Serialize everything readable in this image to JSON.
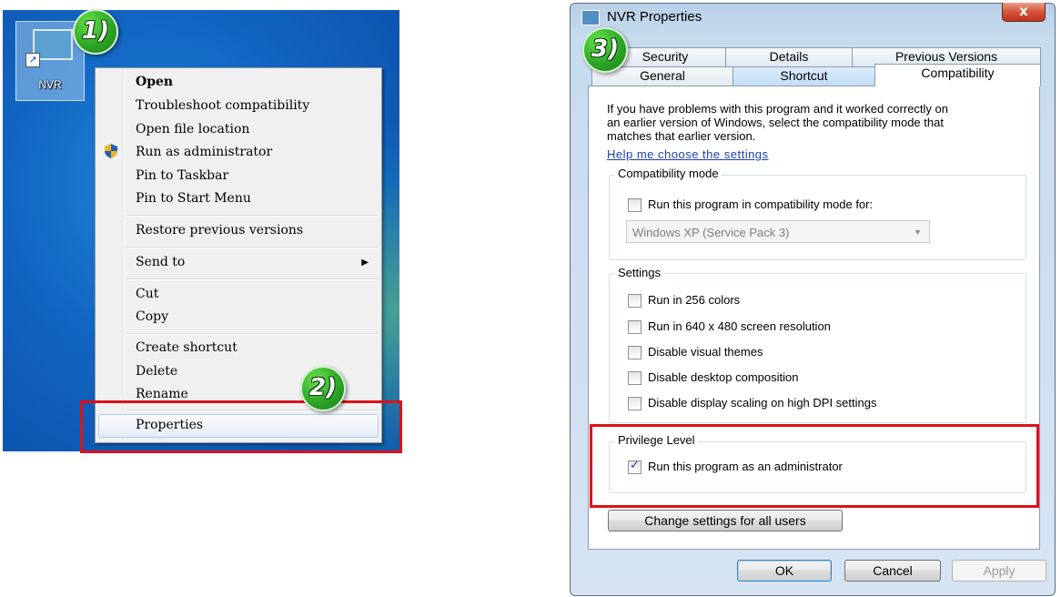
{
  "desktop": {
    "icon_label": "NVR"
  },
  "badges": {
    "step1": "1)",
    "step2": "2)",
    "step3": "3)"
  },
  "context_menu": {
    "items": [
      {
        "label": "Open",
        "bold": true
      },
      {
        "label": "Troubleshoot compatibility"
      },
      {
        "label": "Open file location"
      },
      {
        "label": "Run as administrator",
        "icon": "shield-icon"
      },
      {
        "label": "Pin to Taskbar"
      },
      {
        "label": "Pin to Start Menu"
      },
      {
        "label": "Restore previous versions"
      },
      {
        "label": "Send to",
        "submenu": true
      },
      {
        "label": "Cut"
      },
      {
        "label": "Copy"
      },
      {
        "label": "Create shortcut"
      },
      {
        "label": "Delete"
      },
      {
        "label": "Rename"
      },
      {
        "label": "Properties",
        "highlighted": true
      }
    ]
  },
  "dialog": {
    "title": "NVR Properties",
    "close_label": "x",
    "tabs_row1": [
      "Security",
      "Details",
      "Previous Versions"
    ],
    "tabs_row2": [
      "General",
      "Shortcut",
      "Compatibility"
    ],
    "active_tab": "Compatibility",
    "intro_lines": [
      "If you have problems with this program and it worked correctly on",
      "an earlier version of Windows, select the compatibility mode that",
      "matches that earlier version."
    ],
    "help_link": "Help me choose the settings",
    "compat_mode": {
      "legend": "Compatibility mode",
      "checkbox_label": "Run this program in compatibility mode for:",
      "checked": false,
      "select_value": "Windows XP (Service Pack 3)"
    },
    "settings": {
      "legend": "Settings",
      "options": [
        {
          "label": "Run in 256 colors",
          "checked": false
        },
        {
          "label": "Run in 640 x 480 screen resolution",
          "checked": false
        },
        {
          "label": "Disable visual themes",
          "checked": false
        },
        {
          "label": "Disable desktop composition",
          "checked": false
        },
        {
          "label": "Disable display scaling on high DPI settings",
          "checked": false
        }
      ]
    },
    "privilege": {
      "legend": "Privilege Level",
      "checkbox_label": "Run this program as an administrator",
      "checked": true
    },
    "change_all_users": "Change settings for all users",
    "buttons": {
      "ok": "OK",
      "cancel": "Cancel",
      "apply": "Apply"
    }
  },
  "colors": {
    "highlight_box": "#e0101a",
    "badge_green": "#2ba326",
    "link": "#1a3fb0"
  }
}
